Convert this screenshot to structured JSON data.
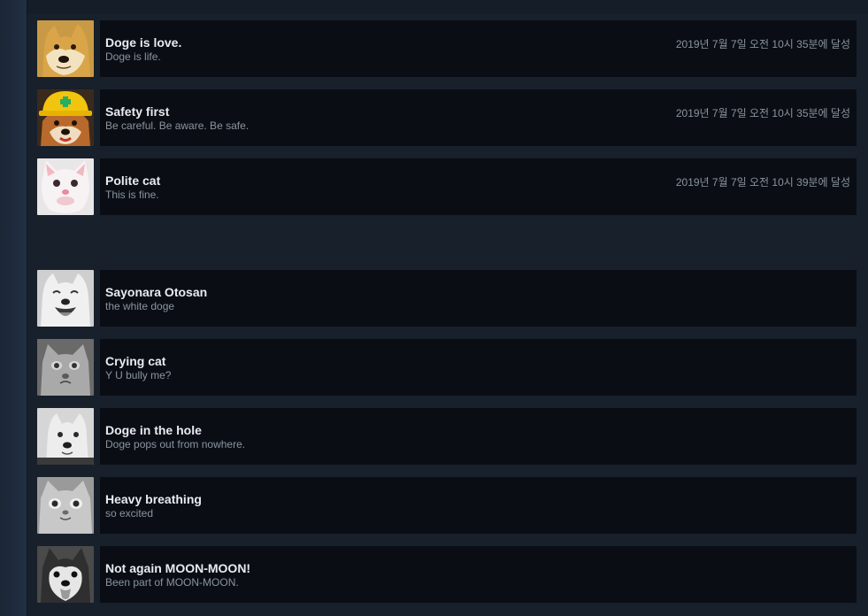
{
  "unlocked": [
    {
      "title": "Doge is love.",
      "description": "Doge is life.",
      "unlock_date": "2019년 7월 7일 오전 10시 35분에 달성",
      "icon": "doge-icon"
    },
    {
      "title": "Safety first",
      "description": "Be careful. Be aware. Be safe.",
      "unlock_date": "2019년 7월 7일 오전 10시 35분에 달성",
      "icon": "hardhat-doge-icon"
    },
    {
      "title": "Polite cat",
      "description": "This is fine.",
      "unlock_date": "2019년 7월 7일 오전 10시 39분에 달성",
      "icon": "polite-cat-icon"
    }
  ],
  "locked": [
    {
      "title": "Sayonara Otosan",
      "description": "the white doge",
      "icon": "white-doge-icon"
    },
    {
      "title": "Crying cat",
      "description": "Y U bully me?",
      "icon": "crying-cat-icon"
    },
    {
      "title": "Doge in the hole",
      "description": "Doge pops out from nowhere.",
      "icon": "doge-in-hole-icon"
    },
    {
      "title": "Heavy breathing",
      "description": "so excited",
      "icon": "heavy-breathing-cat-icon"
    },
    {
      "title": "Not again MOON-MOON!",
      "description": "Been part of MOON-MOON.",
      "icon": "husky-icon"
    }
  ]
}
